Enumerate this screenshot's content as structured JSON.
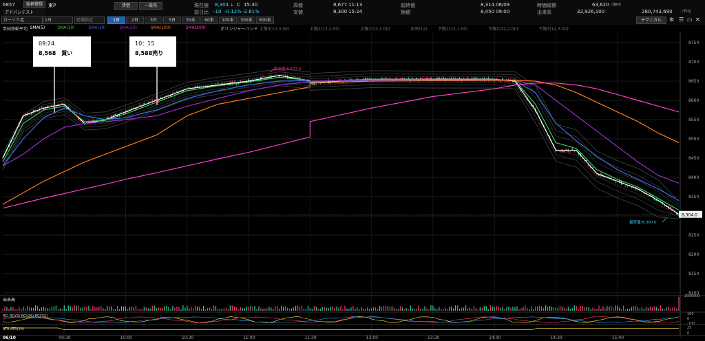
{
  "header": {
    "code": "6857",
    "name": "アドバンテスト",
    "tag1": "銘柄登録",
    "market": "東P",
    "buy_label": "貸借",
    "type_label": "一般売",
    "chart_type": "ローソク足",
    "interval": "1分",
    "adjust": "前場指定",
    "price_label": "現在値",
    "price": "8,304",
    "price_arrow": "↓",
    "price_flag": "C",
    "price_time": "15:30",
    "change_label": "前日比",
    "change": "-10",
    "change_pct": "-0.12%",
    "change_pct2": "-2.61%",
    "high_label": "高値",
    "high": "8,677",
    "high_time": "11:13",
    "low_label": "安値",
    "low": "8,300",
    "low_time": "15:24",
    "prev_close_label": "前終値",
    "prev_close": "8,314",
    "prev_date": "06/09",
    "open_label": "始値",
    "open": "8,450",
    "open_time": "09:00",
    "mcap_label": "時価総額",
    "mcap": "63,620",
    "mcap_unit": "(億円)",
    "volume_label": "出来高",
    "volume": "32,926,100",
    "turnover": "280,743,690",
    "turnover_unit": "(千円)",
    "technical_button": "テクニカル",
    "timeframes": [
      "1日",
      "2日",
      "3日",
      "5日",
      "30本",
      "60本",
      "100本",
      "300本",
      "600本"
    ],
    "active_timeframe": 0
  },
  "legend": [
    {
      "text": "単純移動平均",
      "color": "#cccccc"
    },
    {
      "text": "SMA(5)",
      "color": "#ffffff"
    },
    {
      "text": "SMA(10)",
      "color": "#33cc55"
    },
    {
      "text": "SMA(30)",
      "color": "#3a6fe0"
    },
    {
      "text": "SMA(50)",
      "color": "#9a2fd0"
    },
    {
      "text": "SMA(100)",
      "color": "#ff7a1a"
    },
    {
      "text": "SMA(200)",
      "color": "#ff3fc8"
    },
    {
      "text": "ボリンジャーバンド",
      "color": "#cccccc"
    },
    {
      "text": "上限3(12,3.00)",
      "color": "#777777"
    },
    {
      "text": "上限2(12,2.00)",
      "color": "#777777"
    },
    {
      "text": "上限1(12,1.00)",
      "color": "#777777"
    },
    {
      "text": "中央(12)",
      "color": "#777777"
    },
    {
      "text": "下限1(12,1.00)",
      "color": "#777777"
    },
    {
      "text": "下限2(12,2.00)",
      "color": "#777777"
    },
    {
      "text": "下限3(12,3.00)",
      "color": "#777777"
    }
  ],
  "annotations": [
    {
      "time": "09:24",
      "text": "8,568　買い"
    },
    {
      "time": "10：15",
      "text": "8,588売り"
    }
  ],
  "price_labels": {
    "high_marker": "最高値:8,677.0",
    "low_marker": "最安値:8,300.0",
    "last": "8,304.0"
  },
  "panels": {
    "volume_label": "出来高",
    "volume_max": "2000000",
    "rci_label": "RCI RCI(9) RCI(26) RCI(52)",
    "rci_ticks": [
      "100",
      "0",
      "-100"
    ],
    "atr_label": "ATR ATR(14)",
    "atr_ticks": [
      "25",
      "0"
    ]
  },
  "chart_data": {
    "type": "line",
    "title": "",
    "ylim": [
      8250,
      8775
    ],
    "y_ticks": [
      8750,
      8700,
      8650,
      8600,
      8550,
      8500,
      8450,
      8400,
      8350,
      8300,
      8250,
      8200,
      8150,
      8100
    ],
    "x_ticks": [
      "06/10",
      "09:30",
      "10:00",
      "10:30",
      "11:00",
      "11:30",
      "13:00",
      "13:30",
      "14:00",
      "14:30",
      "15:00"
    ],
    "series": [
      {
        "name": "SMA(5)",
        "color": "#ffffff",
        "x": [
          "09:00",
          "09:10",
          "09:20",
          "09:30",
          "09:40",
          "09:50",
          "10:00",
          "10:15",
          "10:30",
          "10:45",
          "11:00",
          "11:15",
          "11:30",
          "12:30",
          "13:00",
          "13:30",
          "14:00",
          "14:10",
          "14:20",
          "14:30",
          "14:40",
          "14:50",
          "15:00",
          "15:10",
          "15:20",
          "15:30"
        ],
        "values": [
          8450,
          8560,
          8580,
          8590,
          8540,
          8550,
          8570,
          8600,
          8630,
          8640,
          8650,
          8665,
          8650,
          8645,
          8655,
          8655,
          8655,
          8650,
          8575,
          8470,
          8470,
          8410,
          8390,
          8370,
          8340,
          8304
        ]
      },
      {
        "name": "SMA(10)",
        "color": "#33cc55",
        "x": [
          "09:00",
          "09:10",
          "09:20",
          "09:30",
          "09:40",
          "09:50",
          "10:00",
          "10:15",
          "10:30",
          "10:45",
          "11:00",
          "11:15",
          "11:30",
          "12:30",
          "13:00",
          "13:30",
          "14:00",
          "14:10",
          "14:20",
          "14:30",
          "14:40",
          "14:50",
          "15:00",
          "15:10",
          "15:20",
          "15:30"
        ],
        "values": [
          8440,
          8540,
          8575,
          8585,
          8545,
          8548,
          8565,
          8595,
          8625,
          8638,
          8648,
          8660,
          8652,
          8648,
          8655,
          8654,
          8654,
          8652,
          8590,
          8490,
          8475,
          8420,
          8395,
          8375,
          8345,
          8315
        ]
      },
      {
        "name": "SMA(30)",
        "color": "#3a6fe0",
        "x": [
          "09:00",
          "09:10",
          "09:20",
          "09:30",
          "09:40",
          "09:50",
          "10:00",
          "10:15",
          "10:30",
          "10:45",
          "11:00",
          "11:15",
          "11:30",
          "12:30",
          "13:00",
          "13:30",
          "14:00",
          "14:10",
          "14:20",
          "14:30",
          "14:40",
          "14:50",
          "15:00",
          "15:10",
          "15:20",
          "15:30"
        ],
        "values": [
          8430,
          8500,
          8555,
          8580,
          8560,
          8550,
          8555,
          8575,
          8605,
          8625,
          8640,
          8650,
          8652,
          8650,
          8652,
          8652,
          8653,
          8652,
          8620,
          8540,
          8495,
          8455,
          8420,
          8395,
          8370,
          8340
        ]
      },
      {
        "name": "SMA(50)",
        "color": "#9a2fd0",
        "x": [
          "09:00",
          "09:10",
          "09:20",
          "09:30",
          "09:40",
          "09:50",
          "10:00",
          "10:15",
          "10:30",
          "10:45",
          "11:00",
          "11:15",
          "11:30",
          "12:30",
          "13:00",
          "13:30",
          "14:00",
          "14:10",
          "14:20",
          "14:30",
          "14:40",
          "14:50",
          "15:00",
          "15:10",
          "15:20",
          "15:30"
        ],
        "values": [
          8430,
          8460,
          8500,
          8530,
          8540,
          8545,
          8550,
          8560,
          8585,
          8605,
          8625,
          8640,
          8648,
          8650,
          8651,
          8651,
          8652,
          8652,
          8640,
          8600,
          8560,
          8520,
          8480,
          8440,
          8405,
          8385
        ]
      },
      {
        "name": "SMA(100)",
        "color": "#ff7a1a",
        "x": [
          "09:00",
          "09:10",
          "09:20",
          "09:30",
          "09:40",
          "09:50",
          "10:00",
          "10:15",
          "10:30",
          "10:45",
          "11:00",
          "11:15",
          "11:30",
          "12:30",
          "13:00",
          "13:30",
          "14:00",
          "14:10",
          "14:20",
          "14:30",
          "14:40",
          "14:50",
          "15:00",
          "15:10",
          "15:20",
          "15:30"
        ],
        "values": [
          8330,
          8360,
          8390,
          8415,
          8440,
          8460,
          8480,
          8510,
          8560,
          8590,
          8605,
          8620,
          8635,
          8645,
          8650,
          8651,
          8652,
          8652,
          8650,
          8640,
          8620,
          8595,
          8570,
          8545,
          8515,
          8490
        ]
      },
      {
        "name": "SMA(200)",
        "color": "#ff3fc8",
        "x": [
          "09:00",
          "09:10",
          "09:20",
          "09:30",
          "09:40",
          "09:50",
          "10:00",
          "10:15",
          "10:30",
          "10:45",
          "11:00",
          "11:15",
          "11:30",
          "12:30",
          "13:00",
          "13:30",
          "14:00",
          "14:10",
          "14:20",
          "14:30",
          "14:40",
          "14:50",
          "15:00",
          "15:10",
          "15:20",
          "15:30"
        ],
        "values": [
          8320,
          8333,
          8346,
          8358,
          8370,
          8382,
          8395,
          8412,
          8430,
          8448,
          8465,
          8485,
          8505,
          8545,
          8580,
          8610,
          8630,
          8640,
          8645,
          8645,
          8640,
          8630,
          8615,
          8600,
          8585,
          8570
        ]
      }
    ]
  }
}
